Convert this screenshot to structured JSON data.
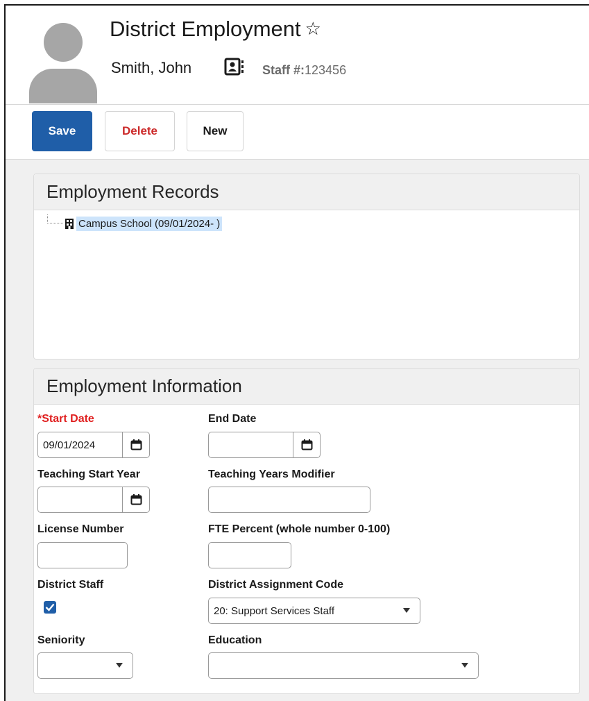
{
  "header": {
    "title": "District Employment",
    "star_icon": "star-outline-icon",
    "person_name": "Smith, John",
    "contact_icon": "contact-card-icon",
    "staff_label": "Staff #:",
    "staff_number": "123456"
  },
  "toolbar": {
    "save_label": "Save",
    "delete_label": "Delete",
    "new_label": "New"
  },
  "records": {
    "title": "Employment Records",
    "items": [
      {
        "label": "Campus School (09/01/2024- )",
        "icon": "building-icon"
      }
    ]
  },
  "info": {
    "title": "Employment Information",
    "start_date": {
      "required_mark": "*",
      "label": "Start Date",
      "value": "09/01/2024"
    },
    "end_date": {
      "label": "End Date",
      "value": ""
    },
    "teaching_start_year": {
      "label": "Teaching Start Year",
      "value": ""
    },
    "teaching_years_modifier": {
      "label": "Teaching Years Modifier",
      "value": ""
    },
    "license_number": {
      "label": "License Number",
      "value": ""
    },
    "fte_percent": {
      "label": "FTE Percent (whole number 0-100)",
      "value": ""
    },
    "district_staff": {
      "label": "District Staff",
      "checked": true
    },
    "district_assignment_code": {
      "label": "District Assignment Code",
      "value": "20: Support Services Staff"
    },
    "seniority": {
      "label": "Seniority",
      "value": ""
    },
    "education": {
      "label": "Education",
      "value": ""
    }
  },
  "colors": {
    "primary_button": "#1f5ea8",
    "delete_text": "#cc2a2a",
    "required_text": "#e02020",
    "selection_highlight": "#cde4fb"
  }
}
